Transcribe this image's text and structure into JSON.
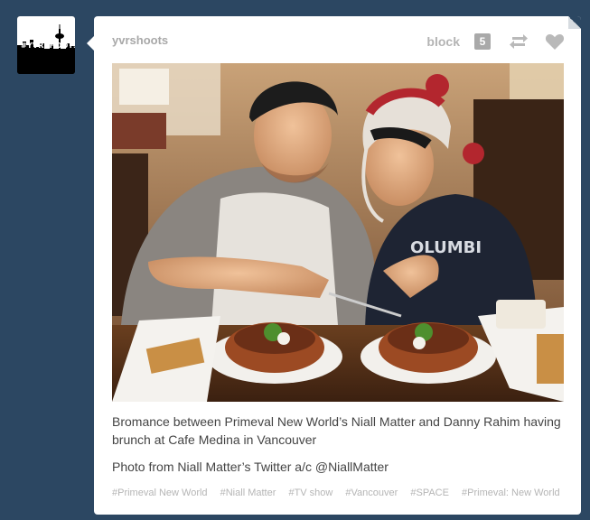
{
  "avatar": {
    "text": "#YVRSHOOTS"
  },
  "post": {
    "blog_name": "yvrshoots",
    "block_label": "block",
    "note_count": "5",
    "icons": [
      "reblog-icon",
      "heart-icon"
    ],
    "caption": [
      "Bromance between Primeval New World’s Niall Matter and Danny Rahim having brunch at Cafe Medina in Vancouver",
      "Photo from Niall Matter’s Twitter a/c @NiallMatter"
    ],
    "tags": [
      "#Primeval New World",
      "#Niall Matter",
      "#TV show",
      "#Vancouver",
      "#SPACE",
      "#Primeval: New World"
    ]
  },
  "colors": {
    "dashboard_bg": "#2c4762",
    "card_bg": "#ffffff",
    "muted_text": "#a8a8a8"
  }
}
